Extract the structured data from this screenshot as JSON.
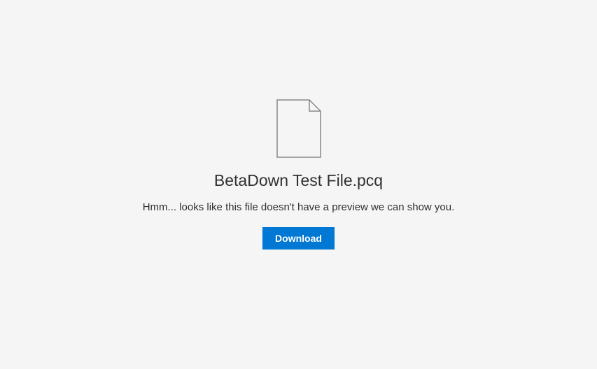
{
  "preview": {
    "icon_name": "file-icon",
    "file_name": "BetaDown Test File.pcq",
    "message": "Hmm... looks like this file doesn't have a preview we can show you.",
    "download_label": "Download"
  },
  "colors": {
    "background": "#f5f5f5",
    "primary": "#0078d4",
    "text": "#323130",
    "icon_stroke": "#8a8886"
  }
}
